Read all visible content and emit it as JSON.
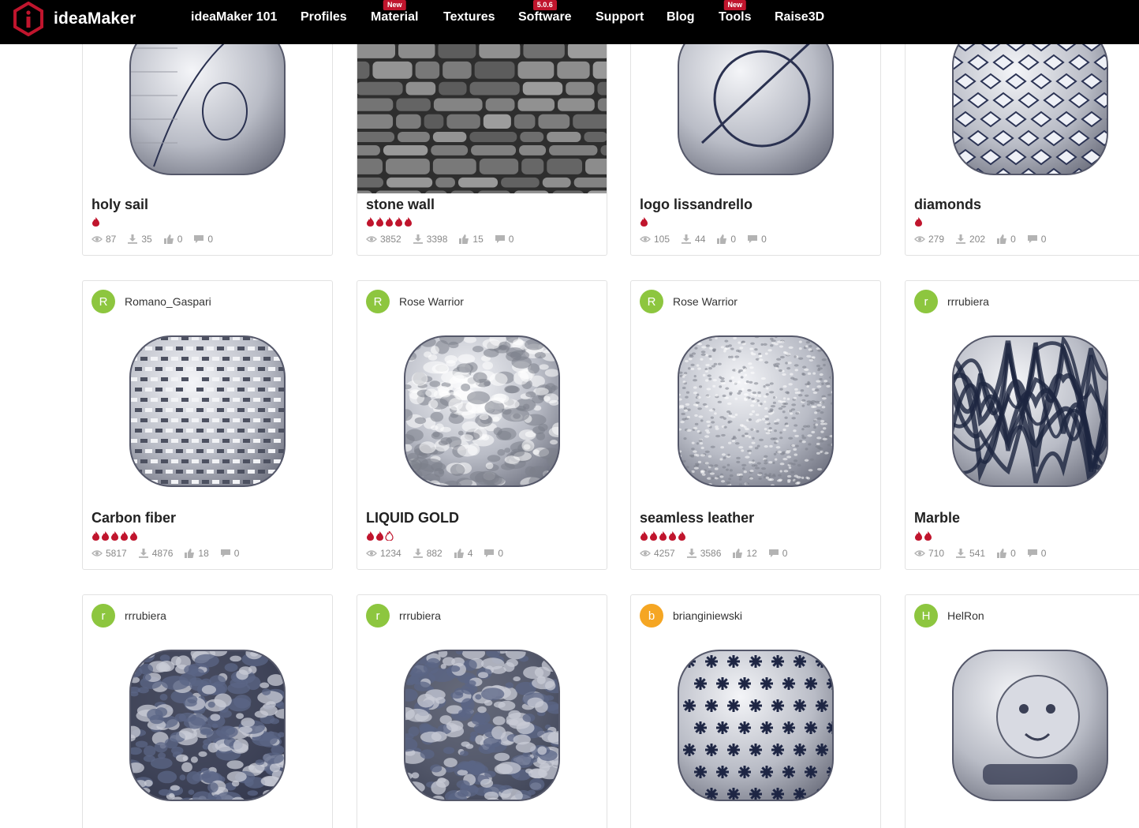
{
  "brand": {
    "name": "ideaMaker"
  },
  "nav": {
    "items": [
      {
        "label": "ideaMaker 101",
        "badge": ""
      },
      {
        "label": "Profiles",
        "badge": ""
      },
      {
        "label": "Material",
        "badge": "New"
      },
      {
        "label": "Textures",
        "badge": ""
      },
      {
        "label": "Software",
        "badge": "5.0.6"
      },
      {
        "label": "Support",
        "badge": ""
      },
      {
        "label": "Blog",
        "badge": ""
      },
      {
        "label": "Tools",
        "badge": "New"
      },
      {
        "label": "Raise3D",
        "badge": ""
      }
    ]
  },
  "colors": {
    "accent": "#c0152d",
    "avatar_green": "#8dc63f",
    "avatar_orange": "#f5a623",
    "nav_bg": "#000000"
  },
  "cards": [
    {
      "author": "",
      "avatar": "",
      "avatar_color": "",
      "title": "holy sail",
      "rating": 1,
      "views": "87",
      "downloads": "35",
      "likes": "0",
      "comments": "0",
      "pattern": "sail"
    },
    {
      "author": "",
      "avatar": "",
      "avatar_color": "",
      "title": "stone wall",
      "rating": 5,
      "views": "3852",
      "downloads": "3398",
      "likes": "15",
      "comments": "0",
      "pattern": "stone"
    },
    {
      "author": "",
      "avatar": "",
      "avatar_color": "",
      "title": "logo lissandrello",
      "rating": 1,
      "views": "105",
      "downloads": "44",
      "likes": "0",
      "comments": "0",
      "pattern": "logo"
    },
    {
      "author": "",
      "avatar": "",
      "avatar_color": "",
      "title": "diamonds",
      "rating": 1,
      "views": "279",
      "downloads": "202",
      "likes": "0",
      "comments": "0",
      "pattern": "diamonds"
    },
    {
      "author": "Romano_Gaspari",
      "avatar": "R",
      "avatar_color": "#8dc63f",
      "title": "Carbon fiber",
      "rating": 5,
      "views": "5817",
      "downloads": "4876",
      "likes": "18",
      "comments": "0",
      "pattern": "carbon"
    },
    {
      "author": "Rose Warrior",
      "avatar": "R",
      "avatar_color": "#8dc63f",
      "title": "LIQUID GOLD",
      "rating": 2.5,
      "views": "1234",
      "downloads": "882",
      "likes": "4",
      "comments": "0",
      "pattern": "liquid"
    },
    {
      "author": "Rose Warrior",
      "avatar": "R",
      "avatar_color": "#8dc63f",
      "title": "seamless leather",
      "rating": 5,
      "views": "4257",
      "downloads": "3586",
      "likes": "12",
      "comments": "0",
      "pattern": "leather"
    },
    {
      "author": "rrrubiera",
      "avatar": "r",
      "avatar_color": "#8dc63f",
      "title": "Marble",
      "rating": 2,
      "views": "710",
      "downloads": "541",
      "likes": "0",
      "comments": "0",
      "pattern": "marble"
    },
    {
      "author": "rrrubiera",
      "avatar": "r",
      "avatar_color": "#8dc63f",
      "title": "",
      "rating": 0,
      "views": "",
      "downloads": "",
      "likes": "",
      "comments": "",
      "pattern": "dark"
    },
    {
      "author": "rrrubiera",
      "avatar": "r",
      "avatar_color": "#8dc63f",
      "title": "",
      "rating": 0,
      "views": "",
      "downloads": "",
      "likes": "",
      "comments": "",
      "pattern": "granite"
    },
    {
      "author": "brianginiewski",
      "avatar": "b",
      "avatar_color": "#f5a623",
      "title": "",
      "rating": 0,
      "views": "",
      "downloads": "",
      "likes": "",
      "comments": "",
      "pattern": "stars"
    },
    {
      "author": "HelRon",
      "avatar": "H",
      "avatar_color": "#8dc63f",
      "title": "",
      "rating": 0,
      "views": "",
      "downloads": "",
      "likes": "",
      "comments": "",
      "pattern": "baby"
    }
  ]
}
